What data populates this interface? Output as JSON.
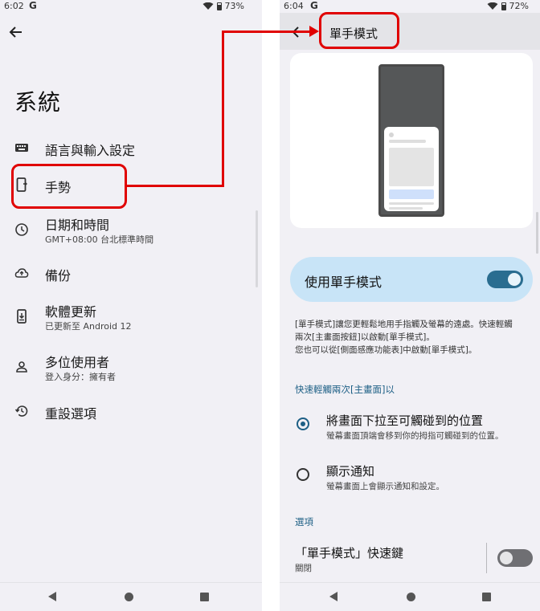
{
  "left_screen": {
    "status": {
      "time": "6:02",
      "g": "G",
      "battery": "73%"
    },
    "title": "系統",
    "items": [
      {
        "title": "語言與輸入設定",
        "subtitle": ""
      },
      {
        "title": "手勢",
        "subtitle": ""
      },
      {
        "title": "日期和時間",
        "subtitle": "GMT+08:00 台北標準時間"
      },
      {
        "title": "備份",
        "subtitle": ""
      },
      {
        "title": "軟體更新",
        "subtitle": "已更新至 Android 12"
      },
      {
        "title": "多位使用者",
        "subtitle": "登入身分：擁有者"
      },
      {
        "title": "重設選項",
        "subtitle": ""
      }
    ]
  },
  "right_screen": {
    "status": {
      "time": "6:04",
      "g": "G",
      "battery": "72%"
    },
    "title": "單手模式",
    "toggle": {
      "label": "使用單手模式",
      "on": true
    },
    "description": [
      "[單手模式]讓您更輕鬆地用手指觸及螢幕的遠處。快速輕觸",
      "兩次[主畫面按鈕]以啟動[單手模式]。",
      "您也可以從[側面感應功能表]中啟動[單手模式]。"
    ],
    "section_double_tap": "快速輕觸兩次[主畫面]以",
    "options": [
      {
        "title": "將畫面下拉至可觸碰到的位置",
        "subtitle": "螢幕畫面頂端會移到你的拇指可觸碰到的位置。",
        "checked": true
      },
      {
        "title": "顯示通知",
        "subtitle": "螢幕畫面上會顯示通知和設定。",
        "checked": false
      }
    ],
    "section_options": "選項",
    "shortcut": {
      "title": "「單手模式」快速鍵",
      "subtitle": "關閉",
      "on": false
    }
  },
  "colors": {
    "highlight": "#e00000",
    "accent": "#1d5f85",
    "toggle_card": "#c8e4f7"
  }
}
